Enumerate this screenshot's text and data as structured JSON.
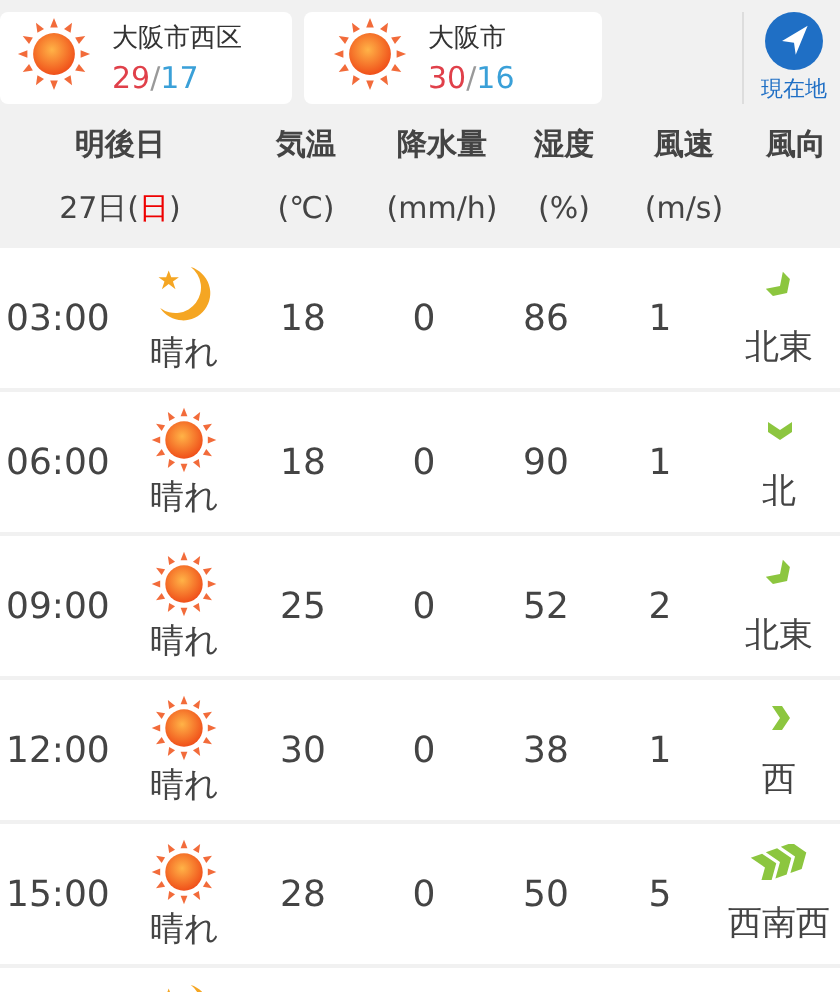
{
  "locations": [
    {
      "name": "大阪市西区",
      "high": "29",
      "separator": "/",
      "low": "17",
      "weather_icon": {
        "kind": "sunny"
      }
    },
    {
      "name": "大阪市",
      "high": "30",
      "separator": "/",
      "low": "16",
      "weather_icon": {
        "kind": "sunny"
      }
    }
  ],
  "current_location": {
    "label": "現在地"
  },
  "header": {
    "day": "明後日",
    "date": "27日(",
    "weekday": "日",
    "date_end": ")",
    "columns": [
      {
        "title": "気温",
        "unit": "(℃)"
      },
      {
        "title": "降水量",
        "unit": "(mm/h)"
      },
      {
        "title": "湿度",
        "unit": "(%)"
      },
      {
        "title": "風速",
        "unit": "(m/s)"
      },
      {
        "title": "風向"
      }
    ]
  },
  "rows": [
    {
      "time": "03:00",
      "weather_icon": {
        "kind": "night"
      },
      "weather": "晴れ",
      "temp": "18",
      "precip": "0",
      "humidity": "86",
      "wind_speed": "1",
      "direction": "北東",
      "wind_icon": {
        "kind": "northeast"
      }
    },
    {
      "time": "06:00",
      "weather_icon": {
        "kind": "sunny"
      },
      "weather": "晴れ",
      "temp": "18",
      "precip": "0",
      "humidity": "90",
      "wind_speed": "1",
      "direction": "北",
      "wind_icon": {
        "kind": "north"
      }
    },
    {
      "time": "09:00",
      "weather_icon": {
        "kind": "sunny"
      },
      "weather": "晴れ",
      "temp": "25",
      "precip": "0",
      "humidity": "52",
      "wind_speed": "2",
      "direction": "北東",
      "wind_icon": {
        "kind": "northeast"
      }
    },
    {
      "time": "12:00",
      "weather_icon": {
        "kind": "sunny"
      },
      "weather": "晴れ",
      "temp": "30",
      "precip": "0",
      "humidity": "38",
      "wind_speed": "1",
      "direction": "西",
      "wind_icon": {
        "kind": "west"
      }
    },
    {
      "time": "15:00",
      "weather_icon": {
        "kind": "sunny"
      },
      "weather": "晴れ",
      "temp": "28",
      "precip": "0",
      "humidity": "50",
      "wind_speed": "5",
      "direction": "西南西",
      "wind_icon": {
        "kind": "strongwest"
      }
    }
  ],
  "partial_row": {
    "weather_icon": {
      "kind": "night"
    }
  }
}
